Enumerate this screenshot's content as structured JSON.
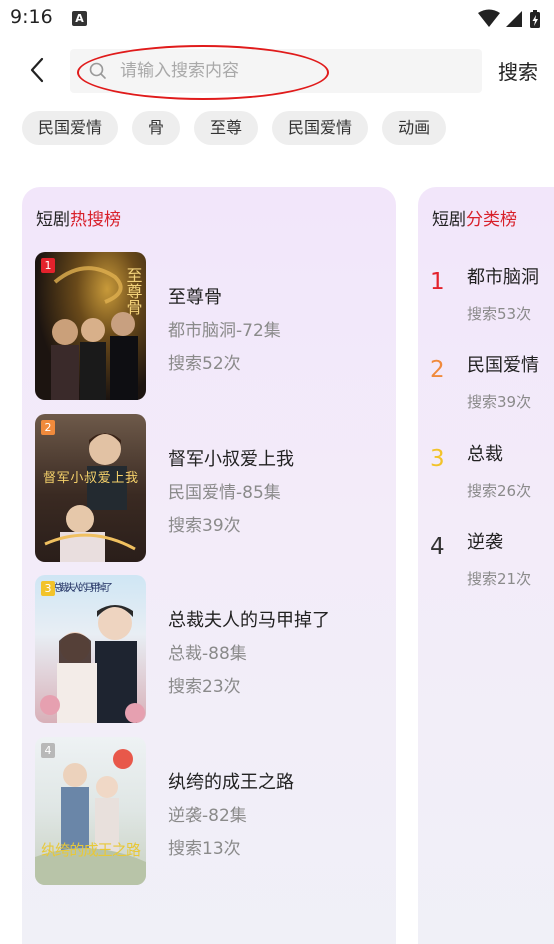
{
  "status_bar": {
    "time": "9:16",
    "notification_icon": "A"
  },
  "search": {
    "placeholder": "请输入搜索内容",
    "value": "",
    "button_label": "搜索"
  },
  "tags": [
    "民国爱情",
    "骨",
    "至尊",
    "民国爱情",
    "动画"
  ],
  "hot_panel": {
    "title_plain": "短剧",
    "title_accent": "热搜榜",
    "items": [
      {
        "rank": "1",
        "title": "至尊骨",
        "meta": "都市脑洞-72集",
        "count": "搜索52次",
        "poster_text": "至尊骨"
      },
      {
        "rank": "2",
        "title": "督军小叔爱上我",
        "meta": "民国爱情-85集",
        "count": "搜索39次",
        "poster_text": "督军小叔爱上我"
      },
      {
        "rank": "3",
        "title": "总裁夫人的马甲掉了",
        "meta": "总裁-88集",
        "count": "搜索23次",
        "poster_text": "总裁夫人的马甲掉了"
      },
      {
        "rank": "4",
        "title": "纨绔的成王之路",
        "meta": "逆袭-82集",
        "count": "搜索13次",
        "poster_text": "纨绔的成王之路"
      }
    ]
  },
  "category_panel": {
    "title_plain": "短剧",
    "title_accent": "分类榜",
    "items": [
      {
        "rank": "1",
        "name": "都市脑洞",
        "count": "搜索53次"
      },
      {
        "rank": "2",
        "name": "民国爱情",
        "count": "搜索39次"
      },
      {
        "rank": "3",
        "name": "总裁",
        "count": "搜索26次"
      },
      {
        "rank": "4",
        "name": "逆袭",
        "count": "搜索21次"
      }
    ]
  },
  "colors": {
    "accent_red": "#d8202a",
    "rank_1": "#e3222c",
    "rank_2": "#f08a3c",
    "rank_3": "#f2c32a",
    "rank_4": "#333333",
    "badge_4": "#b8b8b8",
    "annotation_circle": "#e01b1b"
  }
}
